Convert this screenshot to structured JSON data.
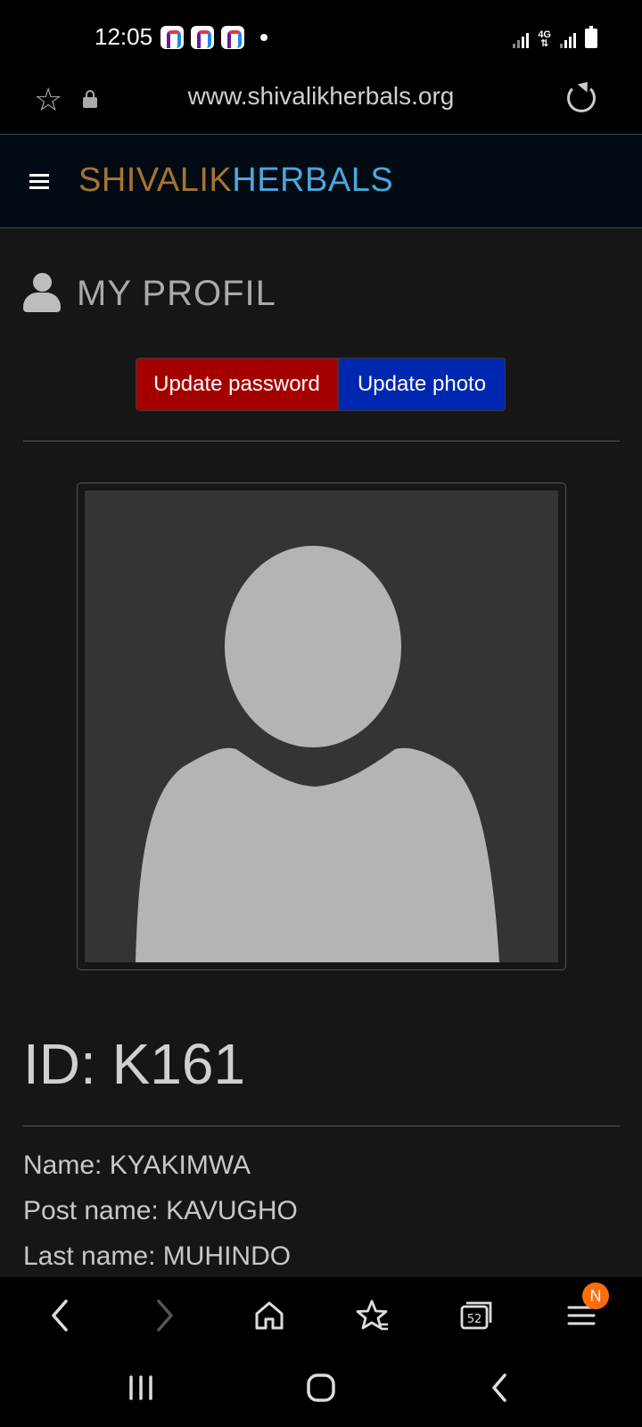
{
  "status_bar": {
    "time": "12:05",
    "network": "4G"
  },
  "browser": {
    "url": "www.shivalikherbals.org",
    "tab_count": "52",
    "menu_badge": "N"
  },
  "navbar": {
    "brand_part1": "SHIVALIK",
    "brand_part2": "HERBALS"
  },
  "profile": {
    "title": "MY PROFIL",
    "update_password_label": "Update password",
    "update_photo_label": "Update photo",
    "id_line": "ID: K161",
    "name_line": "Name: KYAKIMWA",
    "post_name_line": "Post name: KAVUGHO",
    "last_name_line": "Last name: MUHINDO"
  },
  "colors": {
    "brand_part1": "#a6752e",
    "brand_part2": "#4aa8dd",
    "update_password_bg": "#a50000",
    "update_photo_bg": "#0027b0",
    "badge_bg": "#ff6d0a"
  }
}
